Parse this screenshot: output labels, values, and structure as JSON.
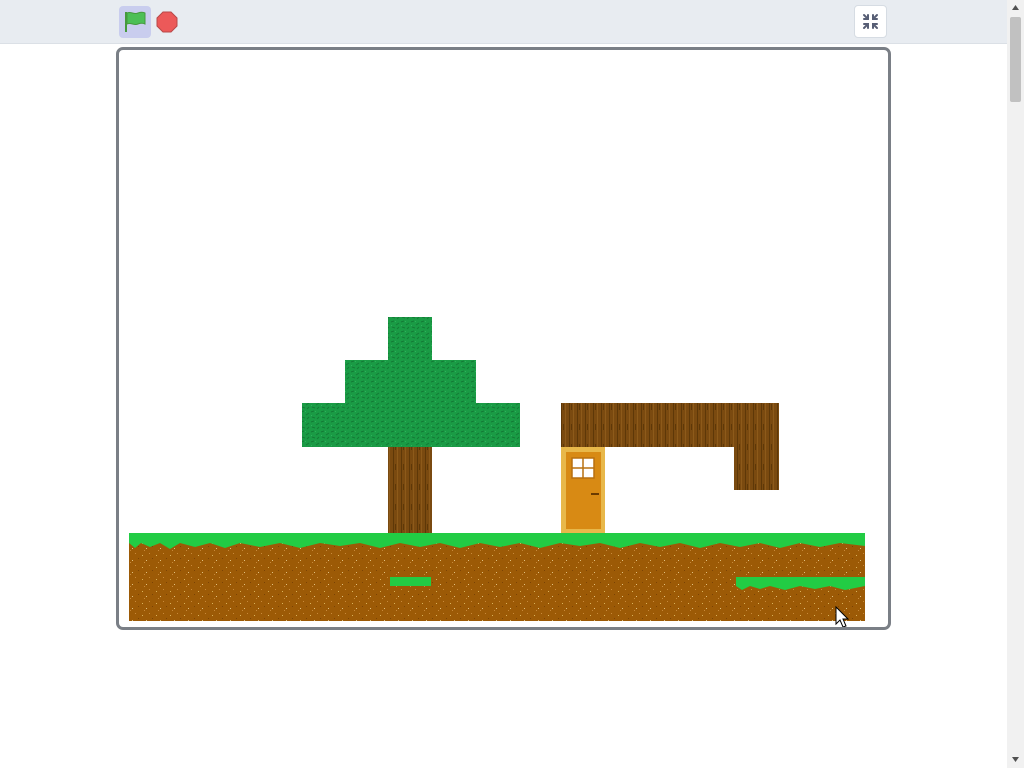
{
  "toolbar": {
    "green_flag": "green-flag",
    "stop": "stop-sign",
    "fullscreen": "exit-fullscreen"
  },
  "colors": {
    "toolbar_bg": "#e8ecf1",
    "flag_active_bg": "#c9cdee",
    "flag_green": "#4cbf56",
    "stop_red": "#ec5959",
    "grass": "#22cc44",
    "dirt": "#9c5a06",
    "leaves": "#1a9b45",
    "wood": "#7a4a10",
    "door": "#d88a14",
    "door_frame": "#e8b84a"
  },
  "scene": {
    "sprites": [
      "tree",
      "house-roof",
      "door",
      "ground",
      "cursor"
    ]
  }
}
